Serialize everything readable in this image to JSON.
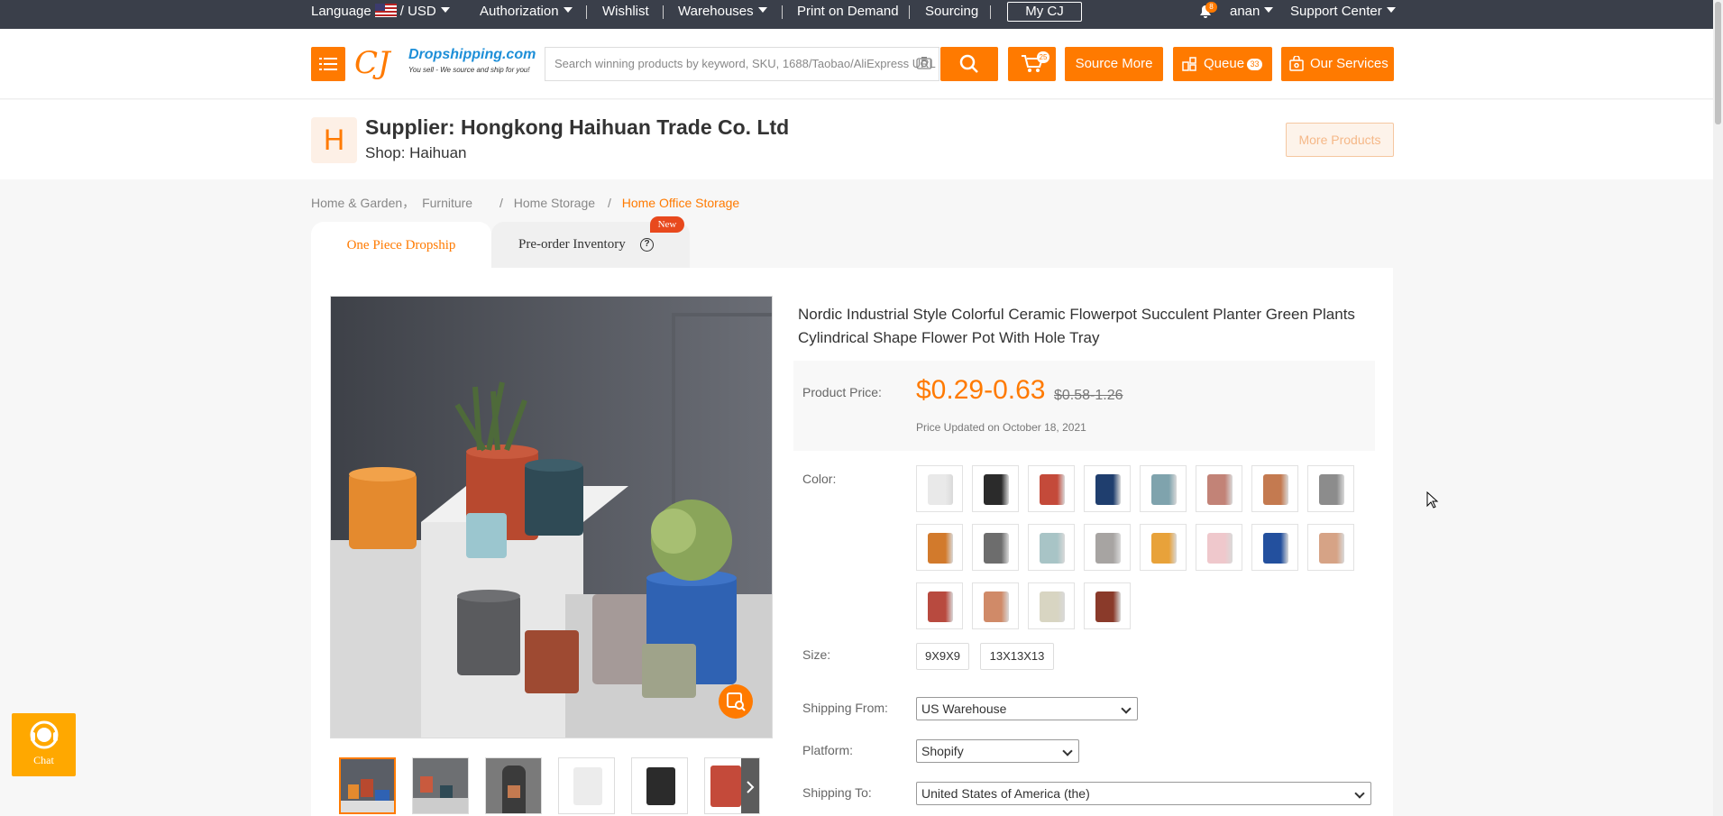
{
  "topbar": {
    "language_label": "Language",
    "currency": "/ USD",
    "authorization": "Authorization",
    "wishlist": "Wishlist",
    "warehouses": "Warehouses",
    "print_on_demand": "Print on Demand",
    "sourcing": "Sourcing",
    "my_cj": "My CJ",
    "notif_count": "8",
    "user": "anan",
    "support_center": "Support Center"
  },
  "header": {
    "logo_text": "Dropshipping.com",
    "logo_tagline": "You sell - We source and ship for you!",
    "search_placeholder": "Search winning products by keyword, SKU, 1688/Taobao/AliExpress URL",
    "cart_count": "25",
    "source_more": "Source More",
    "queue": "Queue",
    "queue_count": "33",
    "our_services": "Our Services"
  },
  "supplier": {
    "avatar_letter": "H",
    "name": "Supplier: Hongkong Haihuan Trade Co. Ltd",
    "shop": "Shop: Haihuan",
    "more_products": "More Products"
  },
  "breadcrumb": [
    "Home & Garden，",
    "Furniture",
    "/",
    "Home Storage",
    "/",
    "Home Office Storage"
  ],
  "tabs": {
    "one_piece": "One Piece Dropship",
    "preorder": "Pre-order Inventory",
    "new_badge": "New"
  },
  "product": {
    "title": "Nordic Industrial Style Colorful Ceramic Flowerpot Succulent Planter Green Plants Cylindrical Shape Flower Pot With Hole Tray",
    "price_label": "Product Price:",
    "price": "$0.29-0.63",
    "old_price": "$0.58-1.26",
    "price_updated": "Price Updated on October 18, 2021",
    "color_label": "Color:",
    "colors": [
      "#e9e9e9",
      "#2b2b2b",
      "#c44a3a",
      "#1f3e6e",
      "#7fa3ad",
      "#c28377",
      "#c47a50",
      "#8c8c8c",
      "#d27a2c",
      "#6d6d6d",
      "#a8c4c6",
      "#a7a4a2",
      "#e8a23a",
      "#efc8cc",
      "#23509e",
      "#d6a386",
      "#b84a3f",
      "#d08a68",
      "#d8d5c2",
      "#8a3a2a"
    ],
    "size_label": "Size:",
    "sizes": [
      "9X9X9",
      "13X13X13"
    ],
    "shipping_from_label": "Shipping From:",
    "shipping_from": "US Warehouse",
    "platform_label": "Platform:",
    "platform": "Shopify",
    "shipping_to_label": "Shipping To:",
    "shipping_to": "United States of America (the)"
  },
  "chat": {
    "label": "Chat"
  }
}
